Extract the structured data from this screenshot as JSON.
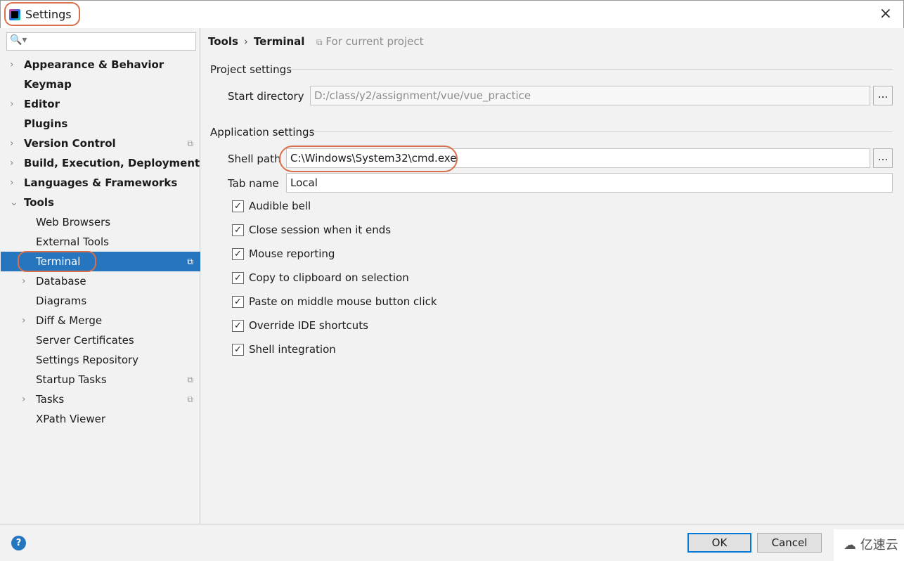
{
  "window": {
    "title": "Settings",
    "close_icon": "×"
  },
  "sidebar": {
    "items": [
      {
        "label": "Appearance & Behavior",
        "expandable": true,
        "bold": true
      },
      {
        "label": "Keymap",
        "bold": true
      },
      {
        "label": "Editor",
        "expandable": true,
        "bold": true
      },
      {
        "label": "Plugins",
        "bold": true
      },
      {
        "label": "Version Control",
        "expandable": true,
        "bold": true,
        "project_scoped": true
      },
      {
        "label": "Build, Execution, Deployment",
        "expandable": true,
        "bold": true
      },
      {
        "label": "Languages & Frameworks",
        "expandable": true,
        "bold": true
      },
      {
        "label": "Tools",
        "expanded": true,
        "bold": true
      },
      {
        "label": "Web Browsers"
      },
      {
        "label": "External Tools"
      },
      {
        "label": "Terminal",
        "selected": true,
        "project_scoped": true
      },
      {
        "label": "Database",
        "expandable": true
      },
      {
        "label": "Diagrams"
      },
      {
        "label": "Diff & Merge",
        "expandable": true
      },
      {
        "label": "Server Certificates"
      },
      {
        "label": "Settings Repository"
      },
      {
        "label": "Startup Tasks",
        "project_scoped": true
      },
      {
        "label": "Tasks",
        "expandable": true,
        "project_scoped": true
      },
      {
        "label": "XPath Viewer"
      }
    ]
  },
  "main": {
    "breadcrumb": [
      "Tools",
      "Terminal"
    ],
    "scope": "For current project",
    "project_section": "Project settings",
    "start_directory_label": "Start directory",
    "start_directory": "D:/class/y2/assignment/vue/vue_practice",
    "app_section": "Application settings",
    "shell_path_label": "Shell path",
    "shell_path": "C:\\Windows\\System32\\cmd.exe",
    "tab_name_label": "Tab name",
    "tab_name": "Local",
    "browse_label": "...",
    "checkboxes": [
      {
        "label": "Audible bell",
        "checked": true
      },
      {
        "label": "Close session when it ends",
        "checked": true
      },
      {
        "label": "Mouse reporting",
        "checked": true
      },
      {
        "label": "Copy to clipboard on selection",
        "checked": true
      },
      {
        "label": "Paste on middle mouse button click",
        "checked": true
      },
      {
        "label": "Override IDE shortcuts",
        "checked": true
      },
      {
        "label": "Shell integration",
        "checked": true
      }
    ]
  },
  "footer": {
    "help": "?",
    "ok": "OK",
    "cancel": "Cancel"
  },
  "watermark": "亿速云",
  "colors": {
    "selection": "#2675bf",
    "highlight": "#d9704d"
  }
}
